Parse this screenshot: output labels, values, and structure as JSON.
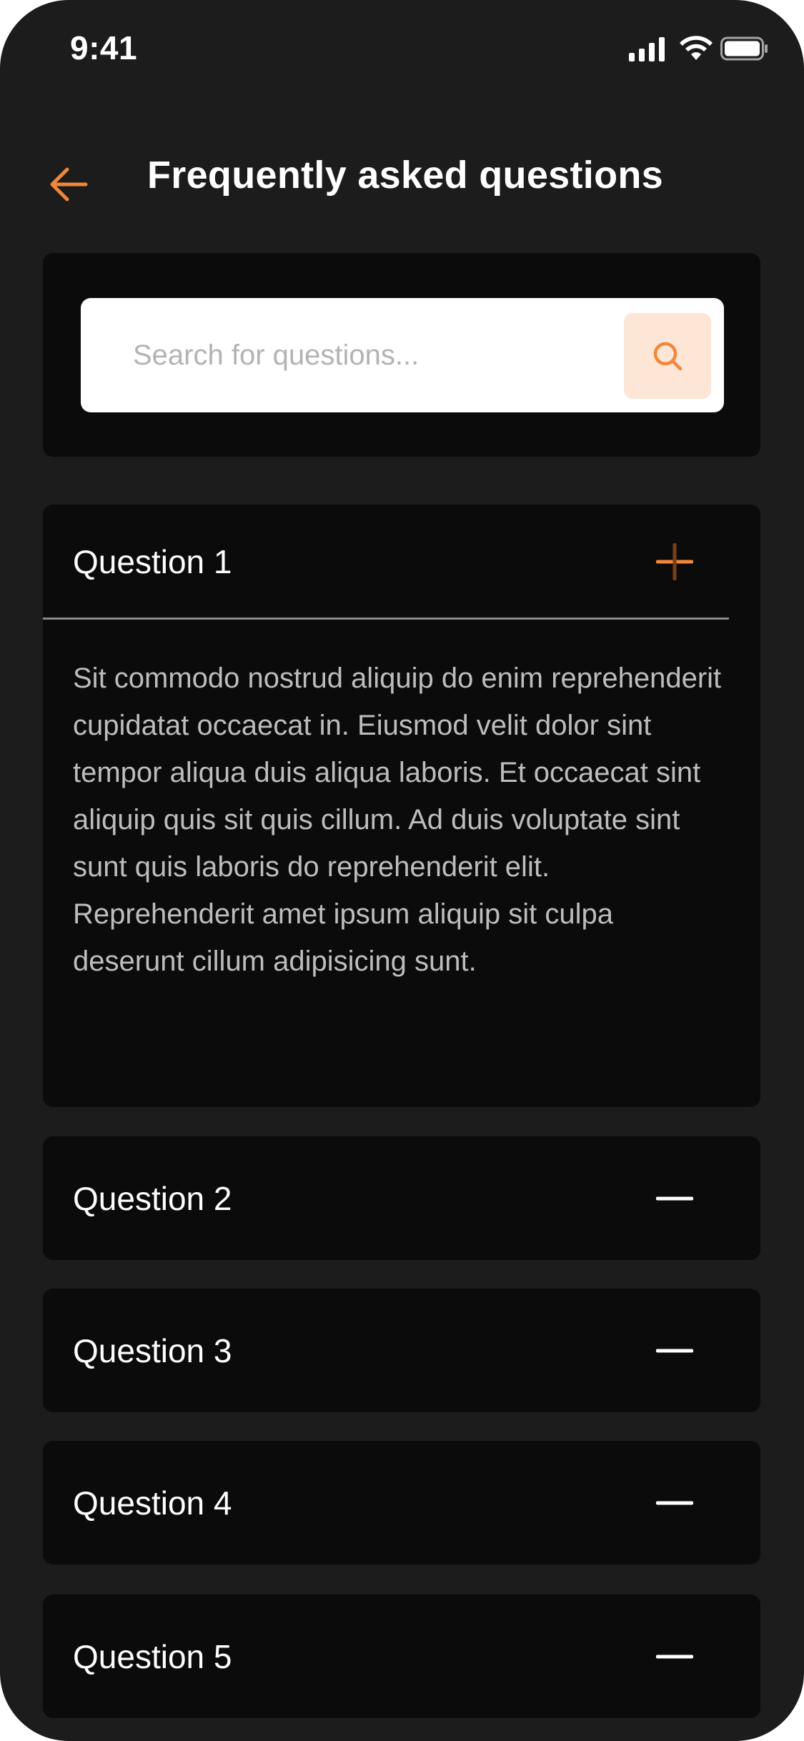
{
  "status_bar": {
    "time": "9:41",
    "icons": [
      "signal-icon",
      "wifi-icon",
      "battery-icon"
    ]
  },
  "header": {
    "back_icon": "arrow-left-icon",
    "title": "Frequently asked questions"
  },
  "search": {
    "placeholder": "Search for questions...",
    "value": "",
    "button_icon": "search-icon"
  },
  "faq": [
    {
      "question": "Question 1",
      "expanded": true,
      "toggle_icon": "plus-icon",
      "answer": "Sit commodo nostrud aliquip do enim reprehenderit cupidatat occaecat in. Eiusmod velit dolor sint tempor aliqua duis aliqua laboris. Et occaecat sint aliquip quis sit quis cillum. Ad duis voluptate sint sunt quis laboris do reprehenderit elit. Reprehenderit amet ipsum aliquip sit culpa deserunt cillum adipisicing sunt."
    },
    {
      "question": "Question 2",
      "expanded": false,
      "toggle_icon": "minus-icon"
    },
    {
      "question": "Question 3",
      "expanded": false,
      "toggle_icon": "minus-icon"
    },
    {
      "question": "Question 4",
      "expanded": false,
      "toggle_icon": "minus-icon"
    },
    {
      "question": "Question 5",
      "expanded": false,
      "toggle_icon": "minus-icon"
    }
  ],
  "colors": {
    "background": "#1c1c1d",
    "card": "#0b0b0b",
    "accent": "#f0873a",
    "search_button_bg": "#fde6d6",
    "text_primary": "#ffffff",
    "text_secondary": "#bdbdbd"
  }
}
